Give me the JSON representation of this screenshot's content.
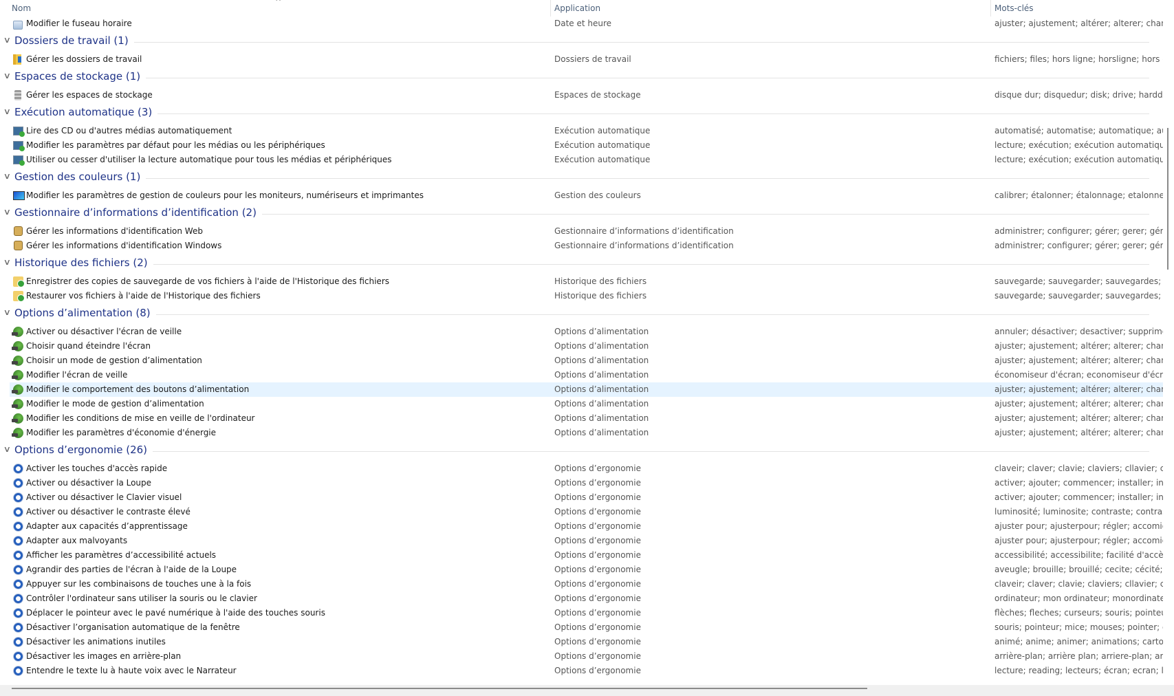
{
  "columns": {
    "name": "Nom",
    "application": "Application",
    "keywords": "Mots-clés"
  },
  "top_items": [
    {
      "icon": "clock",
      "name": "Modifier le fuseau horaire",
      "app": "Date et heure",
      "kw": "ajuster; ajustement; altérer; alterer; changer; m"
    }
  ],
  "groups": [
    {
      "title": "Dossiers de travail (1)",
      "items": [
        {
          "icon": "folder",
          "name": "Gérer les dossiers de travail",
          "app": "Dossiers de travail",
          "kw": "fichiers; files; hors ligne; horsligne; hors conne"
        }
      ]
    },
    {
      "title": "Espaces de stockage (1)",
      "items": [
        {
          "icon": "disk",
          "name": "Gérer les espaces de stockage",
          "app": "Espaces de stockage",
          "kw": "disque dur; disquedur; disk; drive; harddisk; ha"
        }
      ]
    },
    {
      "title": "Exécution automatique (3)",
      "items": [
        {
          "icon": "auto",
          "name": "Lire des CD ou d'autres médias automatiquement",
          "app": "Exécution automatique",
          "kw": "automatisé; automatise; automatique; automa"
        },
        {
          "icon": "auto",
          "name": "Modifier les paramètres par défaut pour les médias ou les périphériques",
          "app": "Exécution automatique",
          "kw": "lecture; exécution; exécution automatique; exe"
        },
        {
          "icon": "auto",
          "name": "Utiliser ou cesser d'utiliser la lecture automatique pour tous les médias et périphériques",
          "app": "Exécution automatique",
          "kw": "lecture; exécution; exécution automatique; exe"
        }
      ]
    },
    {
      "title": "Gestion des couleurs (1)",
      "items": [
        {
          "icon": "color",
          "name": "Modifier les paramètres de gestion de couleurs pour les moniteurs, numériseurs et imprimantes",
          "app": "Gestion des couleurs",
          "kw": "calibrer; étalonner; étalonnage; etalonner; etalo"
        }
      ]
    },
    {
      "title": "Gestionnaire d’informations d’identification (2)",
      "items": [
        {
          "icon": "cred",
          "name": "Gérer les informations d'identification Web",
          "app": "Gestionnaire d’informations d’identification",
          "kw": "administrer; configurer; gérer; gerer; géré; gere"
        },
        {
          "icon": "cred",
          "name": "Gérer les informations d'identification Windows",
          "app": "Gestionnaire d’informations d’identification",
          "kw": "administrer; configurer; gérer; gerer; géré; gere"
        }
      ]
    },
    {
      "title": "Historique des fichiers (2)",
      "items": [
        {
          "icon": "hist",
          "name": "Enregistrer des copies de sauvegarde de vos fichiers à l'aide de l'Historique des fichiers",
          "app": "Historique des fichiers",
          "kw": "sauvegarde; sauvegarder; sauvegardes; stockag"
        },
        {
          "icon": "hist",
          "name": "Restaurer vos fichiers à l'aide de l'Historique des fichiers",
          "app": "Historique des fichiers",
          "kw": "sauvegarde; sauvegarder; sauvegardes; stockag"
        }
      ]
    },
    {
      "title": "Options d’alimentation (8)",
      "items": [
        {
          "icon": "power",
          "name": "Activer ou désactiver l'écran de veille",
          "app": "Options d’alimentation",
          "kw": "annuler; désactiver; desactiver; supprimer; sup"
        },
        {
          "icon": "power",
          "name": "Choisir quand éteindre l'écran",
          "app": "Options d’alimentation",
          "kw": "ajuster; ajustement; altérer; alterer; changer; m"
        },
        {
          "icon": "power",
          "name": "Choisir un mode de gestion d’alimentation",
          "app": "Options d’alimentation",
          "kw": "ajuster; ajustement; altérer; alterer; changer; m"
        },
        {
          "icon": "power",
          "name": "Modifier l'écran de veille",
          "app": "Options d’alimentation",
          "kw": "économiseur d'écran; economiseur d'écran; éc"
        },
        {
          "icon": "power",
          "name": "Modifier le comportement des boutons d’alimentation",
          "app": "Options d’alimentation",
          "kw": "ajuster; ajustement; altérer; alterer; changer; m",
          "selected": true
        },
        {
          "icon": "power",
          "name": "Modifier le mode de gestion d’alimentation",
          "app": "Options d’alimentation",
          "kw": "ajuster; ajustement; altérer; alterer; changer; m"
        },
        {
          "icon": "power",
          "name": "Modifier les conditions de mise en veille de l'ordinateur",
          "app": "Options d’alimentation",
          "kw": "ajuster; ajustement; altérer; alterer; changer; m"
        },
        {
          "icon": "power",
          "name": "Modifier les paramètres d'économie d'énergie",
          "app": "Options d’alimentation",
          "kw": "ajuster; ajustement; altérer; alterer; changer; m"
        }
      ]
    },
    {
      "title": "Options d’ergonomie (26)",
      "items": [
        {
          "icon": "ease",
          "name": "Activer les touches d'accès rapide",
          "app": "Options d’ergonomie",
          "kw": "claveir; claver; clavie; claviers; cllavier; cllaviers;"
        },
        {
          "icon": "ease",
          "name": "Activer ou désactiver la Loupe",
          "app": "Options d’ergonomie",
          "kw": "activer; ajouter; commencer; installer; invoque"
        },
        {
          "icon": "ease",
          "name": "Activer ou désactiver le Clavier visuel",
          "app": "Options d’ergonomie",
          "kw": "activer; ajouter; commencer; installer; invoque"
        },
        {
          "icon": "ease",
          "name": "Activer ou désactiver le contraste élevé",
          "app": "Options d’ergonomie",
          "kw": "luminosité; luminosite; contraste; contraste éle"
        },
        {
          "icon": "ease",
          "name": "Adapter aux capacités d’apprentissage",
          "app": "Options d’ergonomie",
          "kw": "ajuster pour; ajusterpour; régler; accomidate; a"
        },
        {
          "icon": "ease",
          "name": "Adapter aux malvoyants",
          "app": "Options d’ergonomie",
          "kw": "ajuster pour; ajusterpour; régler; accomidate; a"
        },
        {
          "icon": "ease",
          "name": "Afficher les paramètres d’accessibilité actuels",
          "app": "Options d’ergonomie",
          "kw": "accessibilité; accessibilite; facilité d'accès; facil"
        },
        {
          "icon": "ease",
          "name": "Agrandir des parties de l'écran à l'aide de la Loupe",
          "app": "Options d’ergonomie",
          "kw": "aveugle; brouille; brouillé; cecite; cécité; faible"
        },
        {
          "icon": "ease",
          "name": "Appuyer sur les combinaisons de touches une à la fois",
          "app": "Options d’ergonomie",
          "kw": "claveir; claver; clavie; claviers; cllavier; cllaviers;"
        },
        {
          "icon": "ease",
          "name": "Contrôler l'ordinateur sans utiliser la souris ou le clavier",
          "app": "Options d’ergonomie",
          "kw": "ordinateur; mon ordinateur; monordinateur; o"
        },
        {
          "icon": "ease",
          "name": "Déplacer le pointeur avec le pavé numérique à l'aide des touches souris",
          "app": "Options d’ergonomie",
          "kw": "flèches; fleches; curseurs; souris; pointeur; poir"
        },
        {
          "icon": "ease",
          "name": "Désactiver l’organisation automatique de la fenêtre",
          "app": "Options d’ergonomie",
          "kw": "souris; pointeur; mice; mouses; pointer; gestio"
        },
        {
          "icon": "ease",
          "name": "Désactiver les animations inutiles",
          "app": "Options d’ergonomie",
          "kw": "animé; anime; animer; animations; cartoons; a"
        },
        {
          "icon": "ease",
          "name": "Désactiver les images en arrière-plan",
          "app": "Options d’ergonomie",
          "kw": "arrière-plan; arrière plan; arriere-plan; arriere pl"
        },
        {
          "icon": "ease",
          "name": "Entendre le texte lu à haute voix avec le Narrateur",
          "app": "Options d’ergonomie",
          "kw": "lecture; reading; lecteurs; écran; ecran; lecteur"
        }
      ]
    }
  ]
}
